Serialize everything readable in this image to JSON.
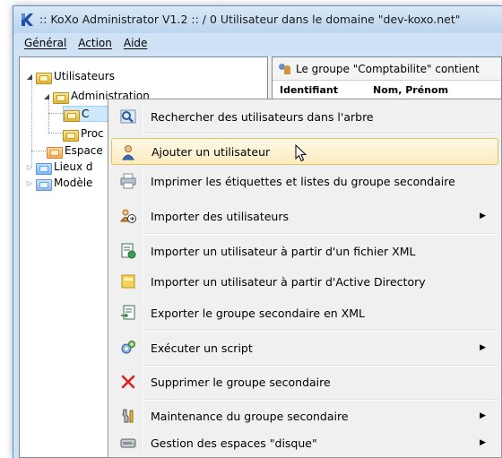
{
  "window": {
    "title": ":: KoXo Administrator V1.2 :: / 0 Utilisateur dans le domaine \"dev-koxo.net\"",
    "logo_icon": "koxo-logo-icon"
  },
  "menubar": {
    "items": [
      "Général",
      "Action",
      "Aide"
    ]
  },
  "tree": {
    "nodes": [
      {
        "label": "Utilisateurs",
        "icon": "folder-icon",
        "expander": "expanded"
      },
      {
        "label": "Administration",
        "icon": "folder-icon",
        "expander": "expanded"
      },
      {
        "label": "C",
        "icon": "folder-icon",
        "expander": "none",
        "selected": true
      },
      {
        "label": "Proc",
        "icon": "folder-icon",
        "expander": "none"
      },
      {
        "label": "Espace",
        "icon": "disk-group-icon",
        "expander": "none"
      },
      {
        "label": "Lieux d",
        "icon": "places-icon",
        "expander": "collapsed"
      },
      {
        "label": "Modèle",
        "icon": "template-icon",
        "expander": "collapsed"
      }
    ]
  },
  "right_pane": {
    "header_text": "Le groupe \"Comptabilite\" contient",
    "column_headers": [
      "Identifiant",
      "Nom, Prénom"
    ]
  },
  "context_menu": {
    "items": [
      {
        "label": "Rechercher des utilisateurs dans l'arbre",
        "icon": "search-tree-icon",
        "submenu": false
      },
      {
        "label": "Ajouter un utilisateur",
        "icon": "add-user-icon",
        "submenu": false,
        "hover": true
      },
      {
        "label": "Imprimer les étiquettes et listes du groupe secondaire",
        "icon": "print-icon",
        "submenu": false
      },
      {
        "label": "Importer des utilisateurs",
        "icon": "import-users-icon",
        "submenu": true
      },
      {
        "label": "Importer un utilisateur à partir d'un fichier XML",
        "icon": "import-xml-icon",
        "submenu": false
      },
      {
        "label": "Importer un utilisateur à partir d'Active Directory",
        "icon": "import-ad-icon",
        "submenu": false
      },
      {
        "label": "Exporter le groupe secondaire en XML",
        "icon": "export-xml-icon",
        "submenu": false
      },
      {
        "label": "Exécuter un script",
        "icon": "script-icon",
        "submenu": true
      },
      {
        "label": "Supprimer le groupe secondaire",
        "icon": "delete-icon",
        "submenu": false
      },
      {
        "label": "Maintenance du groupe secondaire",
        "icon": "maintenance-icon",
        "submenu": true
      },
      {
        "label": "Gestion des espaces \"disque\"",
        "icon": "disk-icon",
        "submenu": true
      }
    ]
  },
  "colors": {
    "hover_bg": "#fdecc0",
    "hover_border": "#e5c365",
    "delete_red": "#e02020",
    "window_frame": "#cfe1f4"
  }
}
